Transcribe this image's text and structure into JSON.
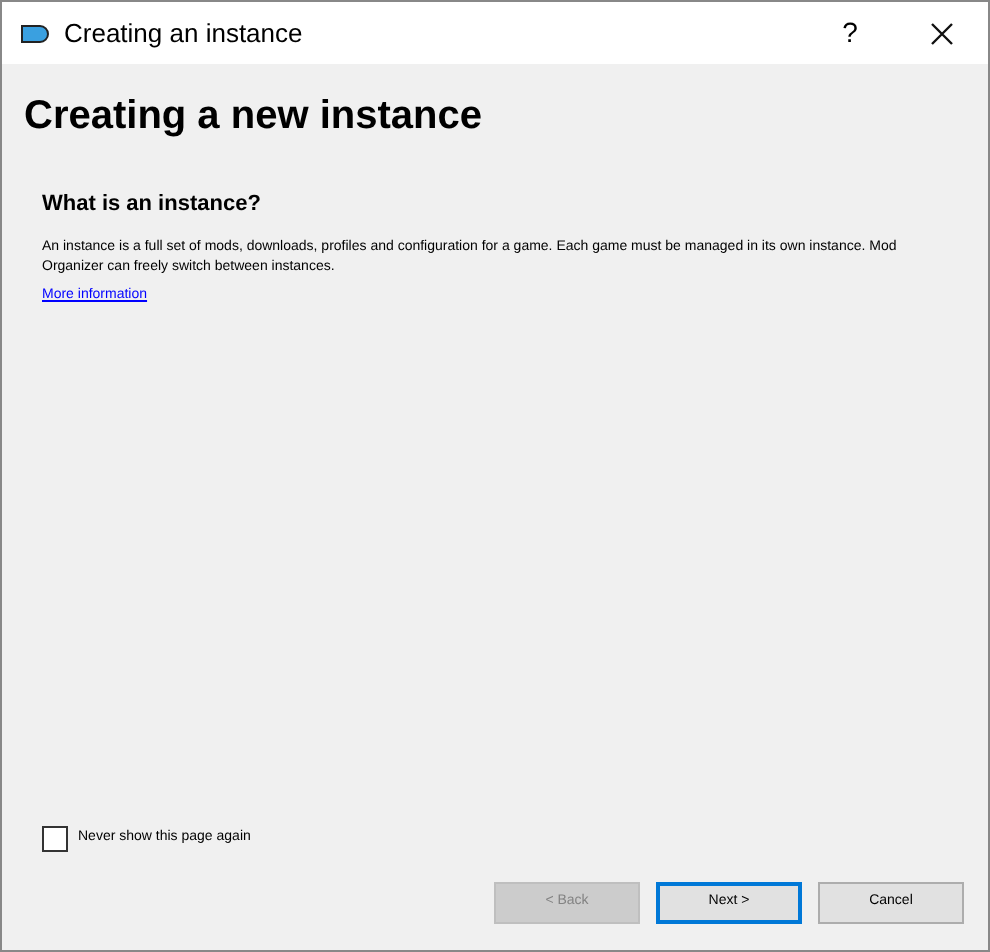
{
  "window": {
    "title": "Creating an instance",
    "help": "?"
  },
  "heading": "Creating a new instance",
  "section": {
    "title": "What is an instance?",
    "body": "An instance is a full set of mods, downloads, profiles and configuration for a game. Each game must be managed in its own instance. Mod Organizer can freely switch between instances.",
    "link": "More information"
  },
  "never_show": {
    "label": "Never show this page again",
    "checked": false
  },
  "buttons": [
    {
      "label": "< Back",
      "disabled": true,
      "focused": false
    },
    {
      "label": "Next >",
      "disabled": false,
      "focused": true
    },
    {
      "label": "Cancel",
      "disabled": false,
      "focused": false
    }
  ]
}
